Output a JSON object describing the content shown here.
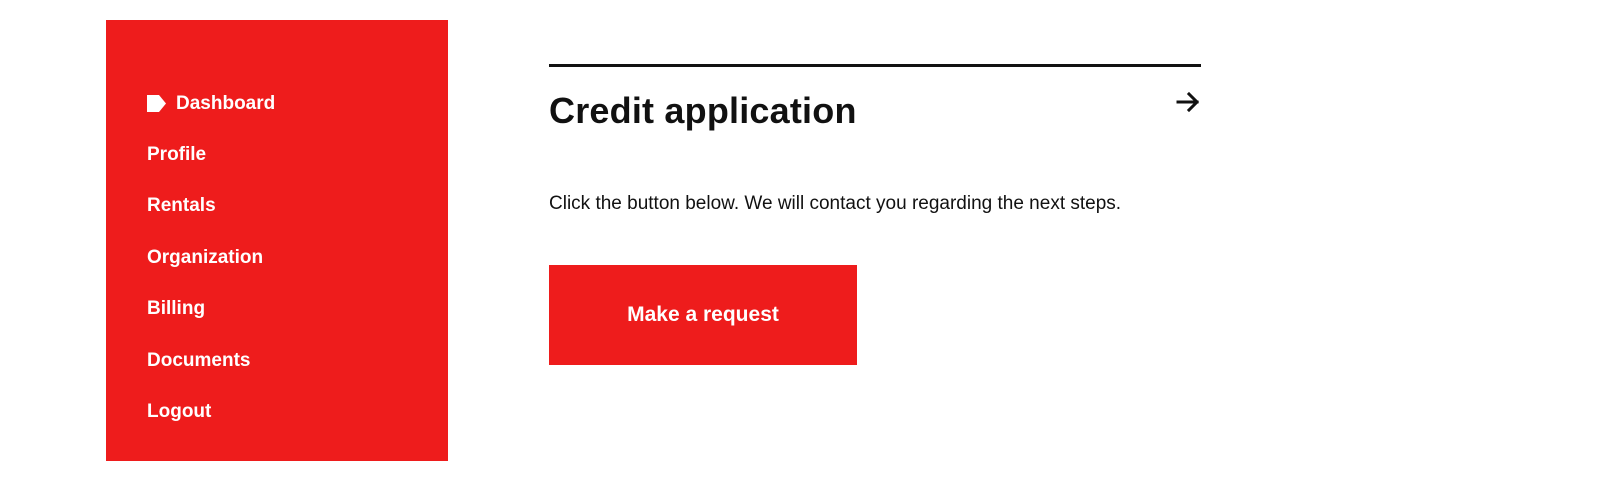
{
  "sidebar": {
    "accent_color": "#ee1c1c",
    "items": [
      {
        "label": "Dashboard",
        "icon": "tag-icon",
        "active": true
      },
      {
        "label": "Profile"
      },
      {
        "label": "Rentals"
      },
      {
        "label": "Organization"
      },
      {
        "label": "Billing"
      },
      {
        "label": "Documents"
      },
      {
        "label": "Logout"
      }
    ]
  },
  "main": {
    "title": "Credit application",
    "arrow_icon": "arrow-right-icon",
    "description": "Click the button below. We will contact you regarding the next steps.",
    "button_label": "Make a request"
  }
}
